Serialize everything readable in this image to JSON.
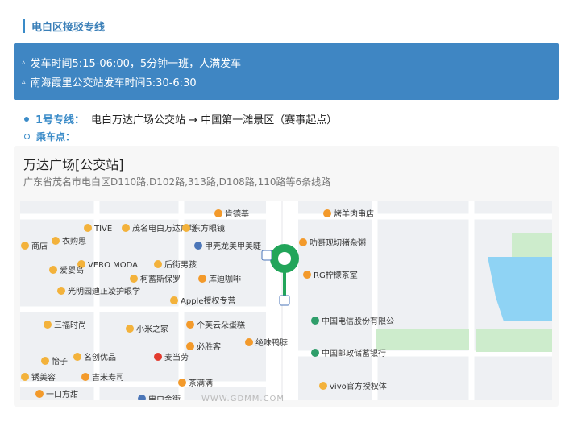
{
  "section": {
    "title": "电白区接驳专线"
  },
  "notice": {
    "lines": [
      "发车时间5:15-06:00，5分钟一班，人满发车",
      "南海霞里公交站发车时间5:30-6:30"
    ]
  },
  "route": {
    "label": "1号专线：",
    "value": "电白万达广场公交站 → 中国第一滩景区（赛事起点）"
  },
  "boarding": {
    "label": "乘车点："
  },
  "stop": {
    "name": "万达广场[公交站]",
    "address": "广东省茂名市电白区D110路,D102路,313路,D108路,110路等6条线路"
  },
  "map": {
    "pois": [
      {
        "label": "肯德基",
        "icon": "food-icon"
      },
      {
        "label": "烤羊肉串店",
        "icon": "food-icon"
      },
      {
        "label": "商店",
        "icon": "shop-icon"
      },
      {
        "label": "TIVE",
        "icon": "shop-icon"
      },
      {
        "label": "茂名电白万达广场",
        "icon": "shop-icon"
      },
      {
        "label": "东方眼镜",
        "icon": "shop-icon"
      },
      {
        "label": "衣购思",
        "icon": "shop-icon"
      },
      {
        "label": "甲壳龙美甲美睫",
        "icon": "dot-icon"
      },
      {
        "label": "叻哥现切猪杂粥",
        "icon": "food-icon"
      },
      {
        "label": "VERO MODA",
        "icon": "shop-icon"
      },
      {
        "label": "后街男孩",
        "icon": "shop-icon"
      },
      {
        "label": "爱婴岛",
        "icon": "shop-icon"
      },
      {
        "label": "柯蓄斯保罗",
        "icon": "shop-icon"
      },
      {
        "label": "库迪咖啡",
        "icon": "food-icon"
      },
      {
        "label": "RG柠檬茶室",
        "icon": "food-icon"
      },
      {
        "label": "光明园迪正凌护眼学习桌椅",
        "icon": "shop-icon"
      },
      {
        "label": "Apple授权专营店",
        "icon": "shop-icon"
      },
      {
        "label": "中国电信股份有限公司(电白分公司)",
        "icon": "building-icon"
      },
      {
        "label": "三福时尚",
        "icon": "shop-icon"
      },
      {
        "label": "小米之家",
        "icon": "shop-icon"
      },
      {
        "label": "个芙云朵蛋糕",
        "icon": "food-icon"
      },
      {
        "label": "绝味鸭脖",
        "icon": "food-icon"
      },
      {
        "label": "必胜客",
        "icon": "food-icon"
      },
      {
        "label": "中国邮政储蓄银行",
        "icon": "bank-icon"
      },
      {
        "label": "怡子",
        "icon": "shop-icon"
      },
      {
        "label": "名创优品",
        "icon": "shop-icon"
      },
      {
        "label": "麦当劳",
        "icon": "mcdonalds-icon"
      },
      {
        "label": "锈美容",
        "icon": "shop-icon"
      },
      {
        "label": "吉米寿司",
        "icon": "food-icon"
      },
      {
        "label": "茶满满",
        "icon": "food-icon"
      },
      {
        "label": "vivo官方授权体验店",
        "icon": "shop-icon"
      },
      {
        "label": "一口方甜",
        "icon": "food-icon"
      },
      {
        "label": "电白金街",
        "icon": "dot-icon"
      }
    ]
  },
  "watermark": "WWW.GDMM.COM",
  "colors": {
    "accent": "#3a8bc8",
    "notice_bg": "#3f86c3",
    "pin": "#22a55a",
    "water": "#8fd3f4",
    "park": "#cdeccc"
  }
}
